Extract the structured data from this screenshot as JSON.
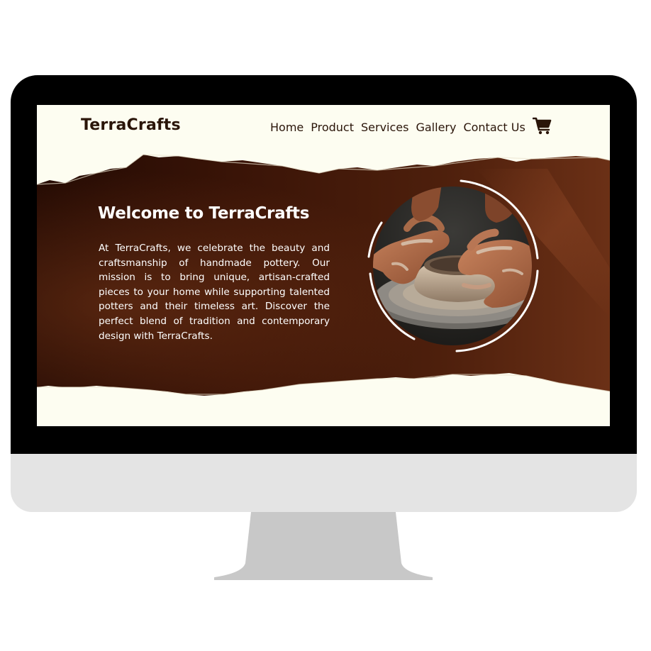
{
  "site": {
    "logo": "TerraCrafts"
  },
  "nav": {
    "items": [
      {
        "label": "Home"
      },
      {
        "label": "Product"
      },
      {
        "label": "Services"
      },
      {
        "label": "Gallery"
      },
      {
        "label": "Contact Us"
      }
    ],
    "cart_icon": "shopping-cart-icon"
  },
  "hero": {
    "title": "Welcome to TerraCrafts",
    "body": "At TerraCrafts, we celebrate the beauty and craftsmanship of handmade pottery. Our mission is to bring unique, artisan-crafted pieces to your home while supporting talented potters and their timeless art. Discover the perfect blend of tradition and contemporary design with TerraCrafts.",
    "image_icon": "pottery-wheel-hands-image"
  },
  "colors": {
    "background": "#fdfdf1",
    "hero_dark": "#2c0f05",
    "hero_mid": "#5e2711",
    "text_dark": "#2a1509",
    "text_light": "#ffffff"
  }
}
